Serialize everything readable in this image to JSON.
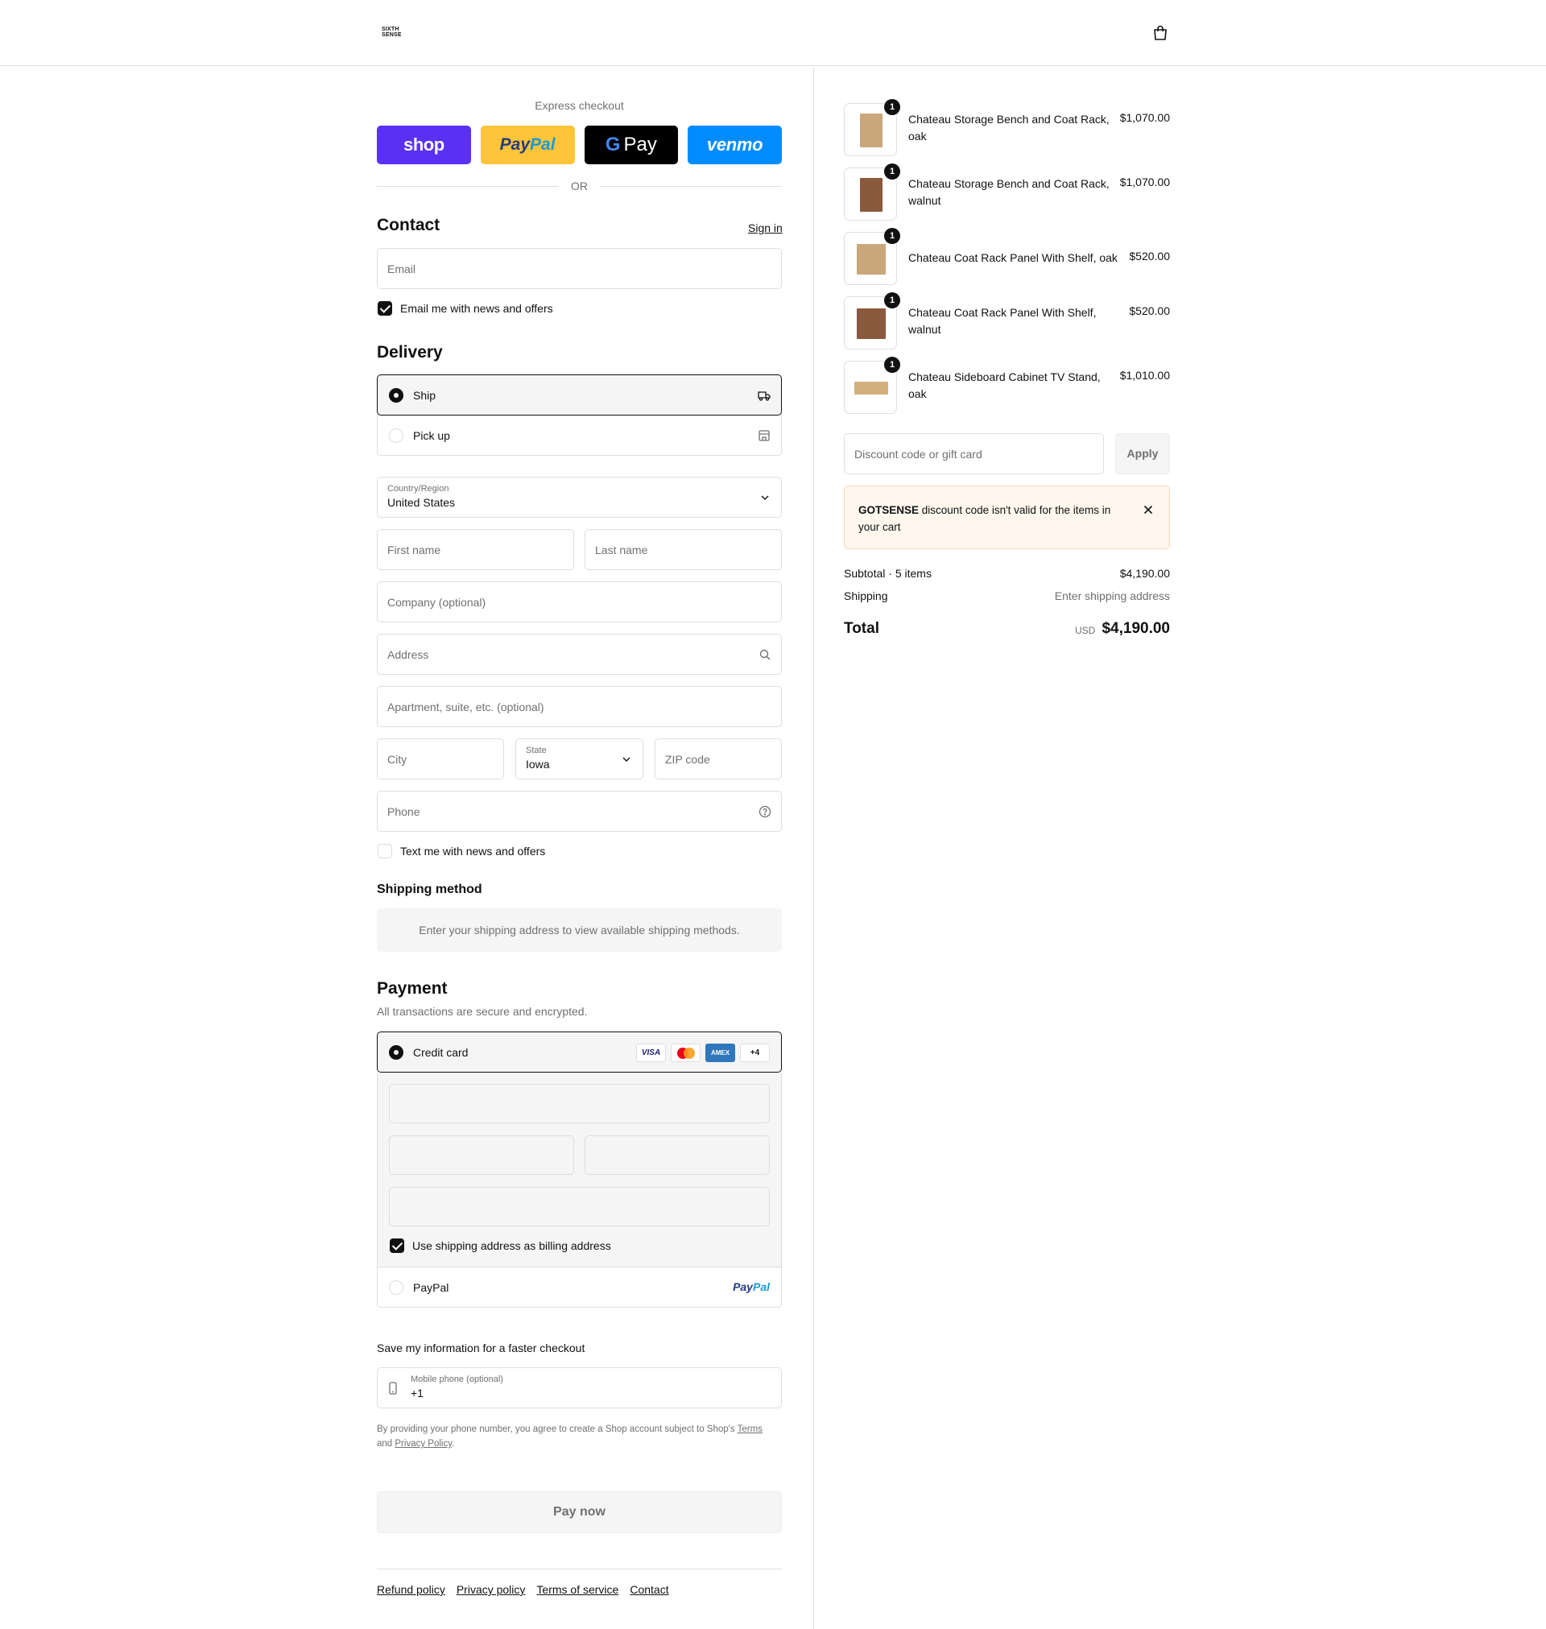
{
  "header": {
    "logo_line1": "SIXTH",
    "logo_line2": "SENSE",
    "cart_icon": "shopping-bag-icon"
  },
  "express": {
    "label": "Express checkout",
    "shop": "shop",
    "paypal_a": "Pay",
    "paypal_b": "Pal",
    "gpay_g": "G",
    "gpay_text": "Pay",
    "venmo": "venmo",
    "or": "OR"
  },
  "contact": {
    "title": "Contact",
    "sign_in": "Sign in",
    "email_placeholder": "Email",
    "news_label": "Email me with news and offers",
    "news_checked": true
  },
  "delivery": {
    "title": "Delivery",
    "ship_label": "Ship",
    "pickup_label": "Pick up",
    "country_label": "Country/Region",
    "country_value": "United States",
    "first_name": "First name",
    "last_name": "Last name",
    "company": "Company (optional)",
    "address": "Address",
    "apartment": "Apartment, suite, etc. (optional)",
    "city": "City",
    "state_label": "State",
    "state_value": "Iowa",
    "zip": "ZIP code",
    "phone": "Phone",
    "text_label": "Text me with news and offers"
  },
  "shipping_method": {
    "title": "Shipping method",
    "info": "Enter your shipping address to view available shipping methods."
  },
  "payment": {
    "title": "Payment",
    "subtitle": "All transactions are secure and encrypted.",
    "credit_card": "Credit card",
    "cards": {
      "visa": "VISA",
      "amex": "AMEX",
      "more": "+4"
    },
    "billing_label": "Use shipping address as billing address",
    "paypal_label": "PayPal",
    "paypal_a": "Pay",
    "paypal_b": "Pal"
  },
  "save_info": {
    "title": "Save my information for a faster checkout",
    "mobile_label": "Mobile phone (optional)",
    "mobile_value": "+1",
    "fine_1": "By providing your phone number, you agree to create a Shop account subject to Shop's",
    "terms": "Terms",
    "and": "and",
    "privacy": "Privacy Policy",
    "period": "."
  },
  "pay_now": "Pay now",
  "footer": [
    "Refund policy",
    "Privacy policy",
    "Terms of service",
    "Contact"
  ],
  "order": {
    "items": [
      {
        "qty": "1",
        "name": "Chateau Storage Bench and Coat Rack, oak",
        "price": "$1,070.00",
        "color": "#c9a77a"
      },
      {
        "qty": "1",
        "name": "Chateau Storage Bench and Coat Rack, walnut",
        "price": "$1,070.00",
        "color": "#8a5a3e"
      },
      {
        "qty": "1",
        "name": "Chateau Coat Rack Panel With Shelf, oak",
        "price": "$520.00",
        "color": "#c9a77a"
      },
      {
        "qty": "1",
        "name": "Chateau Coat Rack Panel With Shelf, walnut",
        "price": "$520.00",
        "color": "#8a5a3e"
      },
      {
        "qty": "1",
        "name": "Chateau Sideboard Cabinet TV Stand, oak",
        "price": "$1,010.00",
        "color": "#d2b07d"
      }
    ],
    "discount_placeholder": "Discount code or gift card",
    "apply": "Apply",
    "alert_code": "GOTSENSE",
    "alert_text": "discount code isn't valid for the items in your cart",
    "subtotal_label": "Subtotal · 5 items",
    "subtotal_value": "$4,190.00",
    "shipping_label": "Shipping",
    "shipping_value": "Enter shipping address",
    "total_label": "Total",
    "currency": "USD",
    "total_value": "$4,190.00"
  }
}
